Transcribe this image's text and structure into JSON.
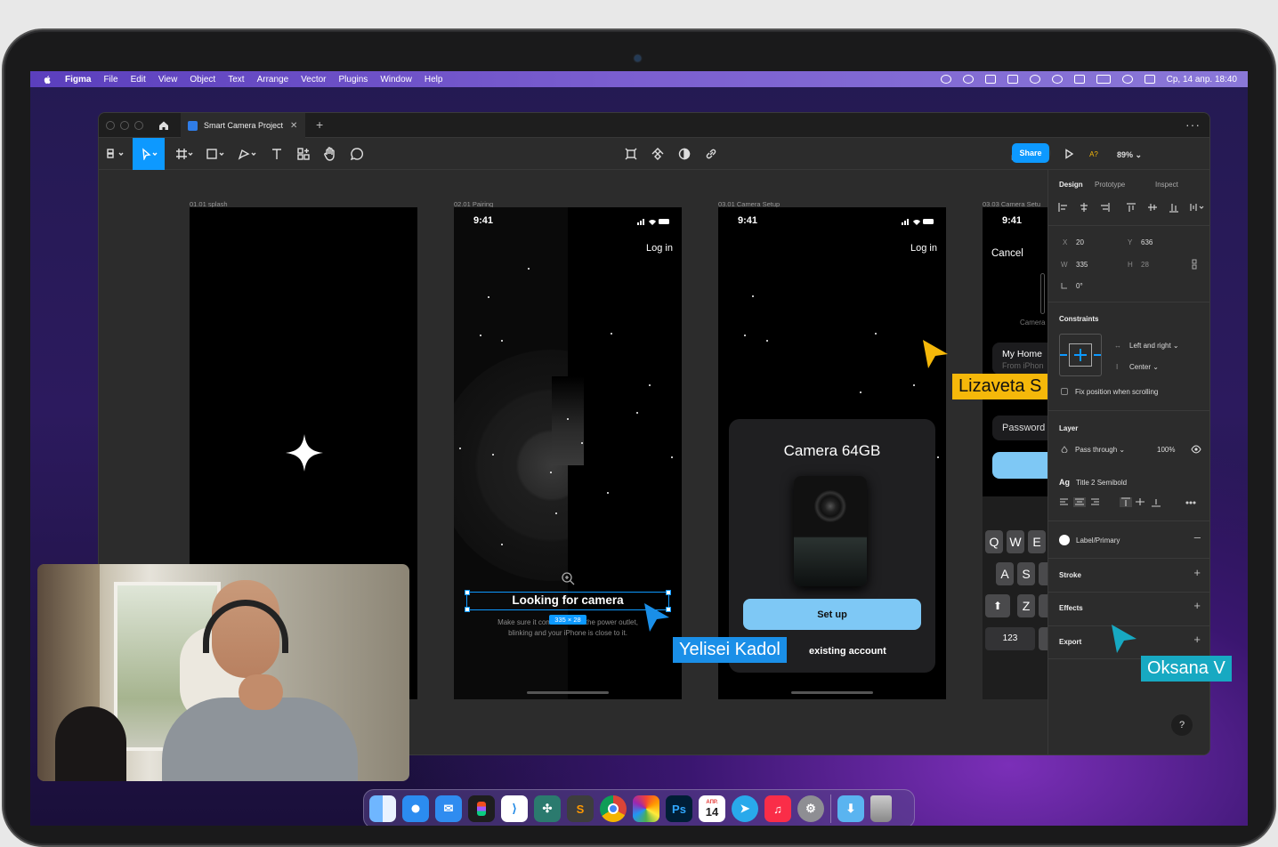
{
  "menubar": {
    "app": "Figma",
    "items": [
      "File",
      "Edit",
      "View",
      "Object",
      "Text",
      "Arrange",
      "Vector",
      "Plugins",
      "Window",
      "Help"
    ],
    "clock": "Ср, 14 апр. 18:40"
  },
  "tabs": {
    "doc_title": "Smart Camera Project"
  },
  "toolbar": {
    "share_label": "Share",
    "zoom": "89%",
    "accessibility_label": "A?"
  },
  "frames": [
    {
      "label": "01.01 splash"
    },
    {
      "label": "02.01 Pairing",
      "time": "9:41",
      "login": "Log in",
      "heading": "Looking for camera",
      "body_line1": "Make sure it con",
      "body_line1b": "the power outlet,",
      "body_line2": "blinking and your iPhone is close to it.",
      "size_badge": "335 × 28"
    },
    {
      "label": "03.01 Camera Setup",
      "time": "9:41",
      "login": "Log in",
      "card_title": "Camera 64GB",
      "button": "Set up",
      "link": "existing account"
    },
    {
      "label": "03.03 Camera Setu",
      "time": "9:41",
      "cancel": "Cancel",
      "camera_caption": "Camera",
      "home_name": "My Home",
      "home_sub": "From iPhon",
      "password": "Password",
      "keys_row1": [
        "Q",
        "W",
        "E"
      ],
      "keys_row2": [
        "A",
        "S"
      ],
      "keys_row3": [
        "Z"
      ],
      "key_num": "123"
    }
  ],
  "panel": {
    "tabs": [
      "Design",
      "Prototype",
      "Inspect"
    ],
    "x_label": "X",
    "x": "20",
    "y_label": "Y",
    "y": "636",
    "w_label": "W",
    "w": "335",
    "h_label": "H",
    "h": "28",
    "rotation": "0°",
    "constraints_title": "Constraints",
    "constraint_h": "Left and right",
    "constraint_v": "Center",
    "fix_position": "Fix position when scrolling",
    "layer_title": "Layer",
    "blend": "Pass through",
    "opacity": "100%",
    "text_style_icon": "Ag",
    "text_style": "Title 2 Semibold",
    "fill_style": "Label/Primary",
    "stroke": "Stroke",
    "effects": "Effects",
    "export": "Export",
    "help": "?"
  },
  "cursors": [
    {
      "name": "Lizaveta S",
      "color": "#f5b80a"
    },
    {
      "name": "Yelisei Kadol",
      "color": "#1a8fe8"
    },
    {
      "name": "Oksana V",
      "color": "#17a9c2"
    }
  ],
  "dock": {
    "apps": [
      "finder-icon",
      "safari-icon",
      "mail-icon",
      "figma-icon",
      "vscode-icon",
      "touch-icon",
      "sublime-icon",
      "chrome-icon",
      "photos-icon",
      "photoshop-icon",
      "calendar-icon",
      "telegram-icon",
      "music-icon",
      "settings-icon",
      "downloads-icon",
      "trash-icon"
    ],
    "ps_label": "Ps",
    "cal_month": "АПР.",
    "cal_day": "14"
  }
}
